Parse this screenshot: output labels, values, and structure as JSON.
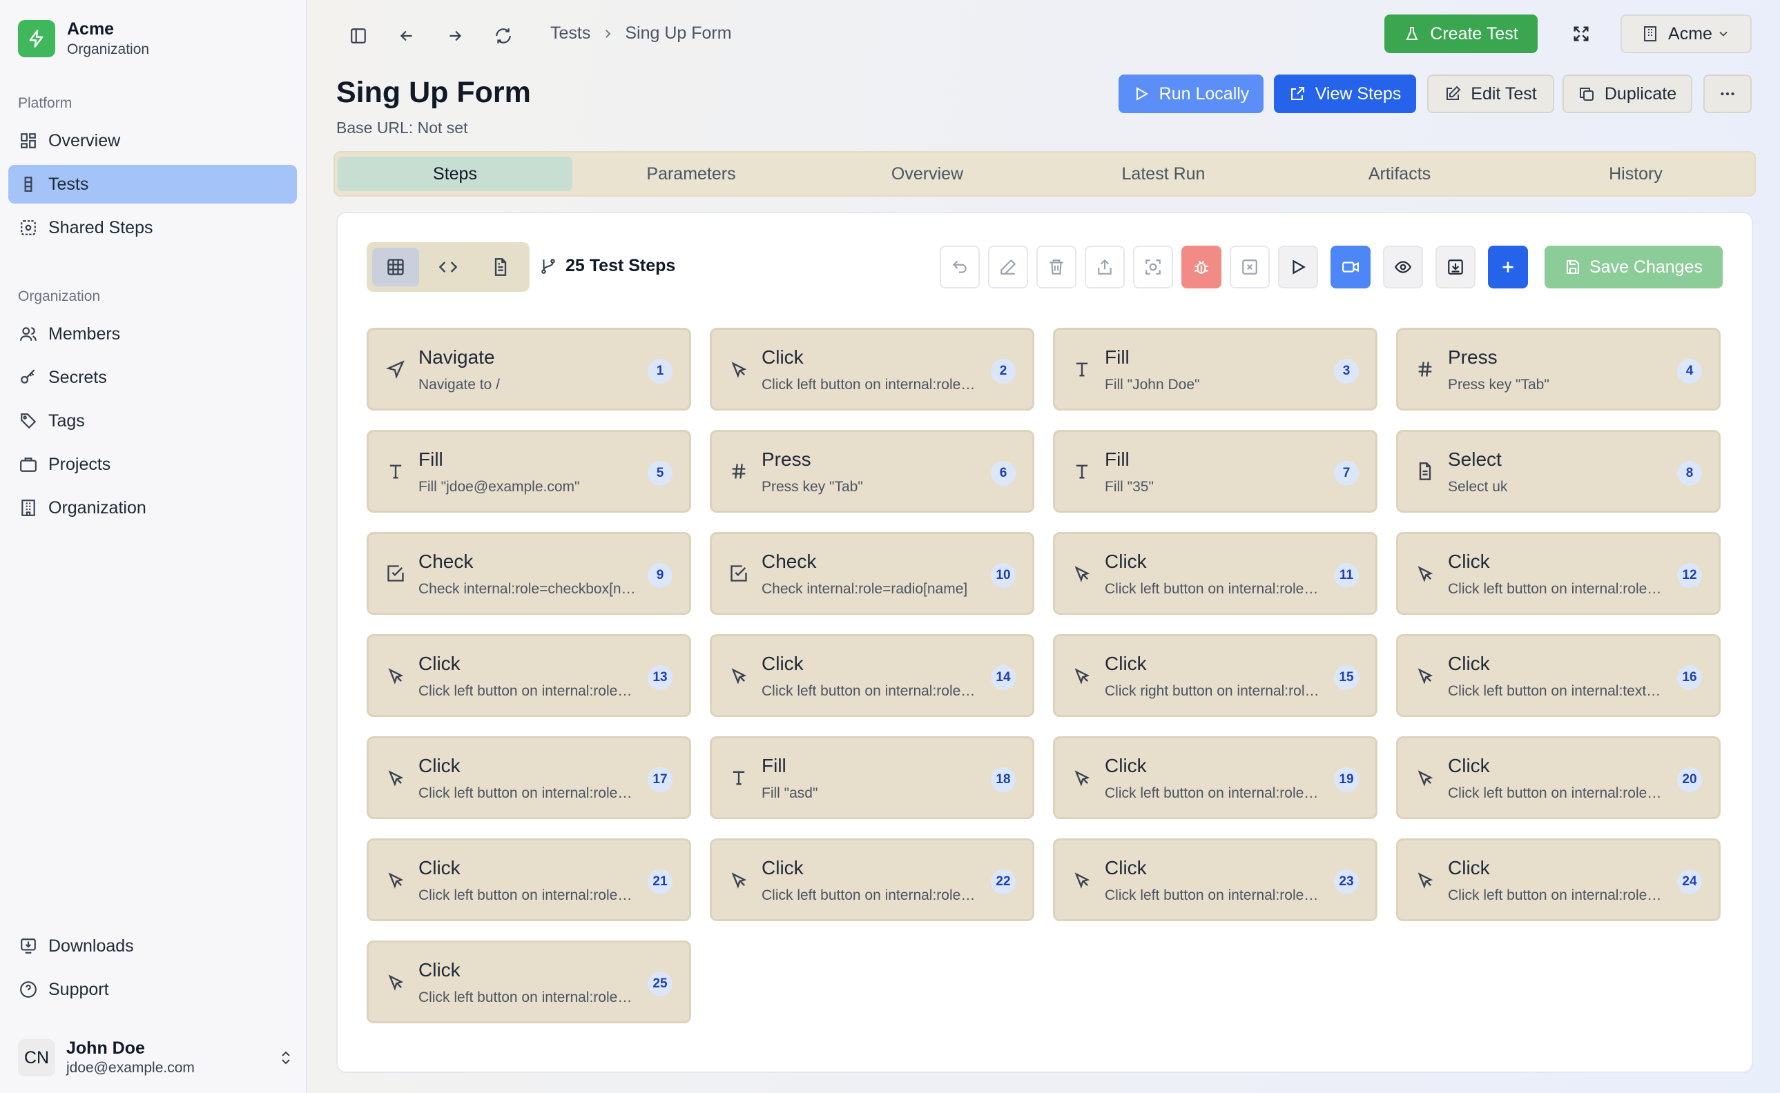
{
  "brand": {
    "name": "Acme",
    "subtitle": "Organization"
  },
  "sidebar": {
    "platform_label": "Platform",
    "platform_items": [
      {
        "label": "Overview",
        "icon": "dashboard-icon",
        "active": false
      },
      {
        "label": "Tests",
        "icon": "flask-icon",
        "active": true
      },
      {
        "label": "Shared Steps",
        "icon": "shared-steps-icon",
        "active": false
      }
    ],
    "org_label": "Organization",
    "org_items": [
      {
        "label": "Members",
        "icon": "users-icon"
      },
      {
        "label": "Secrets",
        "icon": "key-icon"
      },
      {
        "label": "Tags",
        "icon": "tag-icon"
      },
      {
        "label": "Projects",
        "icon": "briefcase-icon"
      },
      {
        "label": "Organization",
        "icon": "building-icon"
      }
    ],
    "bottom_items": [
      {
        "label": "Downloads",
        "icon": "download-icon"
      },
      {
        "label": "Support",
        "icon": "help-circle-icon"
      }
    ]
  },
  "user": {
    "initials": "CN",
    "name": "John Doe",
    "email": "jdoe@example.com"
  },
  "breadcrumb": {
    "parent": "Tests",
    "current": "Sing Up Form"
  },
  "header": {
    "create_test": "Create Test",
    "org_switch": "Acme",
    "title": "Sing Up Form",
    "base_url": "Base URL: Not set",
    "run_locally": "Run Locally",
    "view_steps": "View Steps",
    "edit_test": "Edit Test",
    "duplicate": "Duplicate"
  },
  "tabs": [
    "Steps",
    "Parameters",
    "Overview",
    "Latest Run",
    "Artifacts",
    "History"
  ],
  "active_tab": 0,
  "toolbar": {
    "step_count": "25 Test Steps",
    "save_changes": "Save Changes"
  },
  "colors": {
    "accent": "#2563eb",
    "green": "#3aa650",
    "card_bg": "#e7decb",
    "danger": "#f28b86"
  },
  "steps": [
    {
      "n": "1",
      "title": "Navigate",
      "desc": "Navigate to /",
      "icon": "navigate-icon"
    },
    {
      "n": "2",
      "title": "Click",
      "desc": "Click left button on internal:role=button",
      "icon": "cursor-click-icon"
    },
    {
      "n": "3",
      "title": "Fill",
      "desc": "Fill \"John Doe\"",
      "icon": "text-icon"
    },
    {
      "n": "4",
      "title": "Press",
      "desc": "Press key \"Tab\"",
      "icon": "hash-icon"
    },
    {
      "n": "5",
      "title": "Fill",
      "desc": "Fill \"jdoe@example.com\"",
      "icon": "text-icon"
    },
    {
      "n": "6",
      "title": "Press",
      "desc": "Press key \"Tab\"",
      "icon": "hash-icon"
    },
    {
      "n": "7",
      "title": "Fill",
      "desc": "Fill \"35\"",
      "icon": "text-icon"
    },
    {
      "n": "8",
      "title": "Select",
      "desc": "Select uk",
      "icon": "document-icon"
    },
    {
      "n": "9",
      "title": "Check",
      "desc": "Check internal:role=checkbox[name]",
      "icon": "checkbox-icon"
    },
    {
      "n": "10",
      "title": "Check",
      "desc": "Check internal:role=radio[name]",
      "icon": "checkbox-icon"
    },
    {
      "n": "11",
      "title": "Click",
      "desc": "Click left button on internal:role=button",
      "icon": "cursor-click-icon"
    },
    {
      "n": "12",
      "title": "Click",
      "desc": "Click left button on internal:role=button",
      "icon": "cursor-click-icon"
    },
    {
      "n": "13",
      "title": "Click",
      "desc": "Click left button on internal:role=button",
      "icon": "cursor-click-icon"
    },
    {
      "n": "14",
      "title": "Click",
      "desc": "Click left button on internal:role=button",
      "icon": "cursor-click-icon"
    },
    {
      "n": "15",
      "title": "Click",
      "desc": "Click right button on internal:role=button",
      "icon": "cursor-click-icon"
    },
    {
      "n": "16",
      "title": "Click",
      "desc": "Click left button on internal:text=button",
      "icon": "cursor-click-icon"
    },
    {
      "n": "17",
      "title": "Click",
      "desc": "Click left button on internal:role=button",
      "icon": "cursor-click-icon"
    },
    {
      "n": "18",
      "title": "Fill",
      "desc": "Fill \"asd\"",
      "icon": "text-icon"
    },
    {
      "n": "19",
      "title": "Click",
      "desc": "Click left button on internal:role=button",
      "icon": "cursor-click-icon"
    },
    {
      "n": "20",
      "title": "Click",
      "desc": "Click left button on internal:role=button",
      "icon": "cursor-click-icon"
    },
    {
      "n": "21",
      "title": "Click",
      "desc": "Click left button on internal:role=button",
      "icon": "cursor-click-icon"
    },
    {
      "n": "22",
      "title": "Click",
      "desc": "Click left button on internal:role=button",
      "icon": "cursor-click-icon"
    },
    {
      "n": "23",
      "title": "Click",
      "desc": "Click left button on internal:role=button",
      "icon": "cursor-click-icon"
    },
    {
      "n": "24",
      "title": "Click",
      "desc": "Click left button on internal:role=button",
      "icon": "cursor-click-icon"
    },
    {
      "n": "25",
      "title": "Click",
      "desc": "Click left button on internal:role=button",
      "icon": "cursor-click-icon"
    }
  ]
}
